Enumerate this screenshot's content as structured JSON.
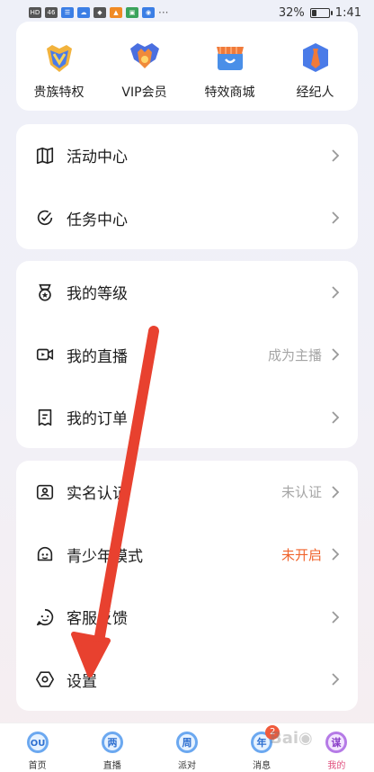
{
  "status_bar": {
    "left_chips": [
      "HD",
      "46",
      "☰",
      "▲"
    ],
    "battery_percent": "32%",
    "battery_level": 0.32,
    "time": "1:41"
  },
  "shortcuts": [
    {
      "label": "贵族特权",
      "icon": "noble-badge-icon"
    },
    {
      "label": "VIP会员",
      "icon": "vip-crown-icon"
    },
    {
      "label": "特效商城",
      "icon": "shop-icon"
    },
    {
      "label": "经纪人",
      "icon": "agent-icon"
    }
  ],
  "group1": [
    {
      "label": "活动中心",
      "icon": "map-icon"
    },
    {
      "label": "任务中心",
      "icon": "check-circle-icon"
    }
  ],
  "group2": [
    {
      "label": "我的等级",
      "icon": "level-medal-icon",
      "value": ""
    },
    {
      "label": "我的直播",
      "icon": "video-camera-icon",
      "value": "成为主播"
    },
    {
      "label": "我的订单",
      "icon": "receipt-icon",
      "value": ""
    }
  ],
  "group3": [
    {
      "label": "实名认证",
      "icon": "id-card-icon",
      "value": "未认证"
    },
    {
      "label": "青少年模式",
      "icon": "teen-mode-icon",
      "value": "未开启"
    },
    {
      "label": "客服反馈",
      "icon": "feedback-icon",
      "value": ""
    },
    {
      "label": "设置",
      "icon": "settings-hexagon-icon",
      "value": ""
    }
  ],
  "bottom_nav": [
    {
      "label": "首页",
      "glyph": "OU"
    },
    {
      "label": "直播",
      "glyph": "两"
    },
    {
      "label": "派对",
      "glyph": "周"
    },
    {
      "label": "消息",
      "glyph": "年",
      "badge": "2"
    },
    {
      "label": "我的",
      "glyph": "谋"
    }
  ],
  "colors": {
    "accent_orange": "#f0642c",
    "active_pink": "#e0507e",
    "arrow_red": "#e8412f"
  }
}
